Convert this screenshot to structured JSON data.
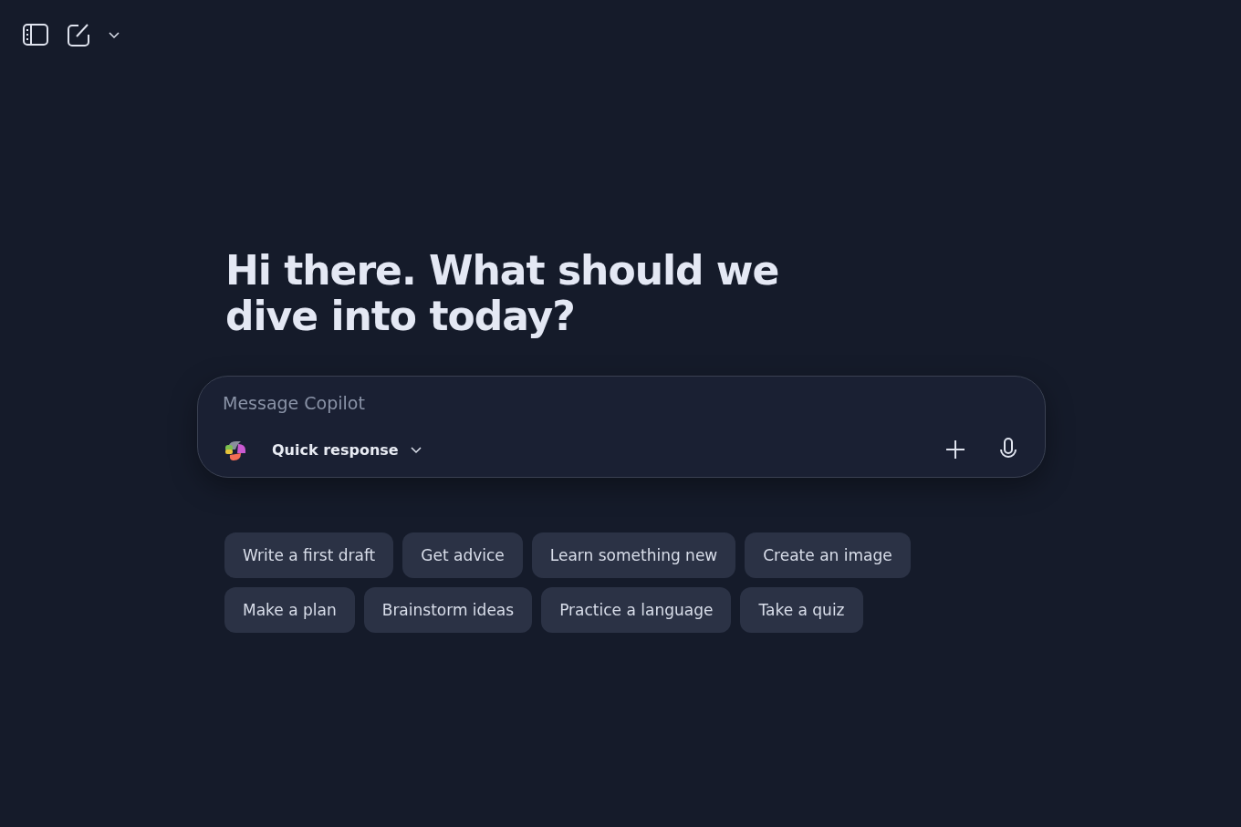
{
  "greeting": "Hi there. What should we dive into today?",
  "composer": {
    "placeholder": "Message Copilot",
    "mode": "Quick response"
  },
  "suggestions": [
    {
      "label": "Write a first draft"
    },
    {
      "label": "Get advice"
    },
    {
      "label": "Learn something new"
    },
    {
      "label": "Create an image"
    },
    {
      "label": "Make a plan"
    },
    {
      "label": "Brainstorm ideas"
    },
    {
      "label": "Practice a language"
    },
    {
      "label": "Take a quiz"
    }
  ]
}
